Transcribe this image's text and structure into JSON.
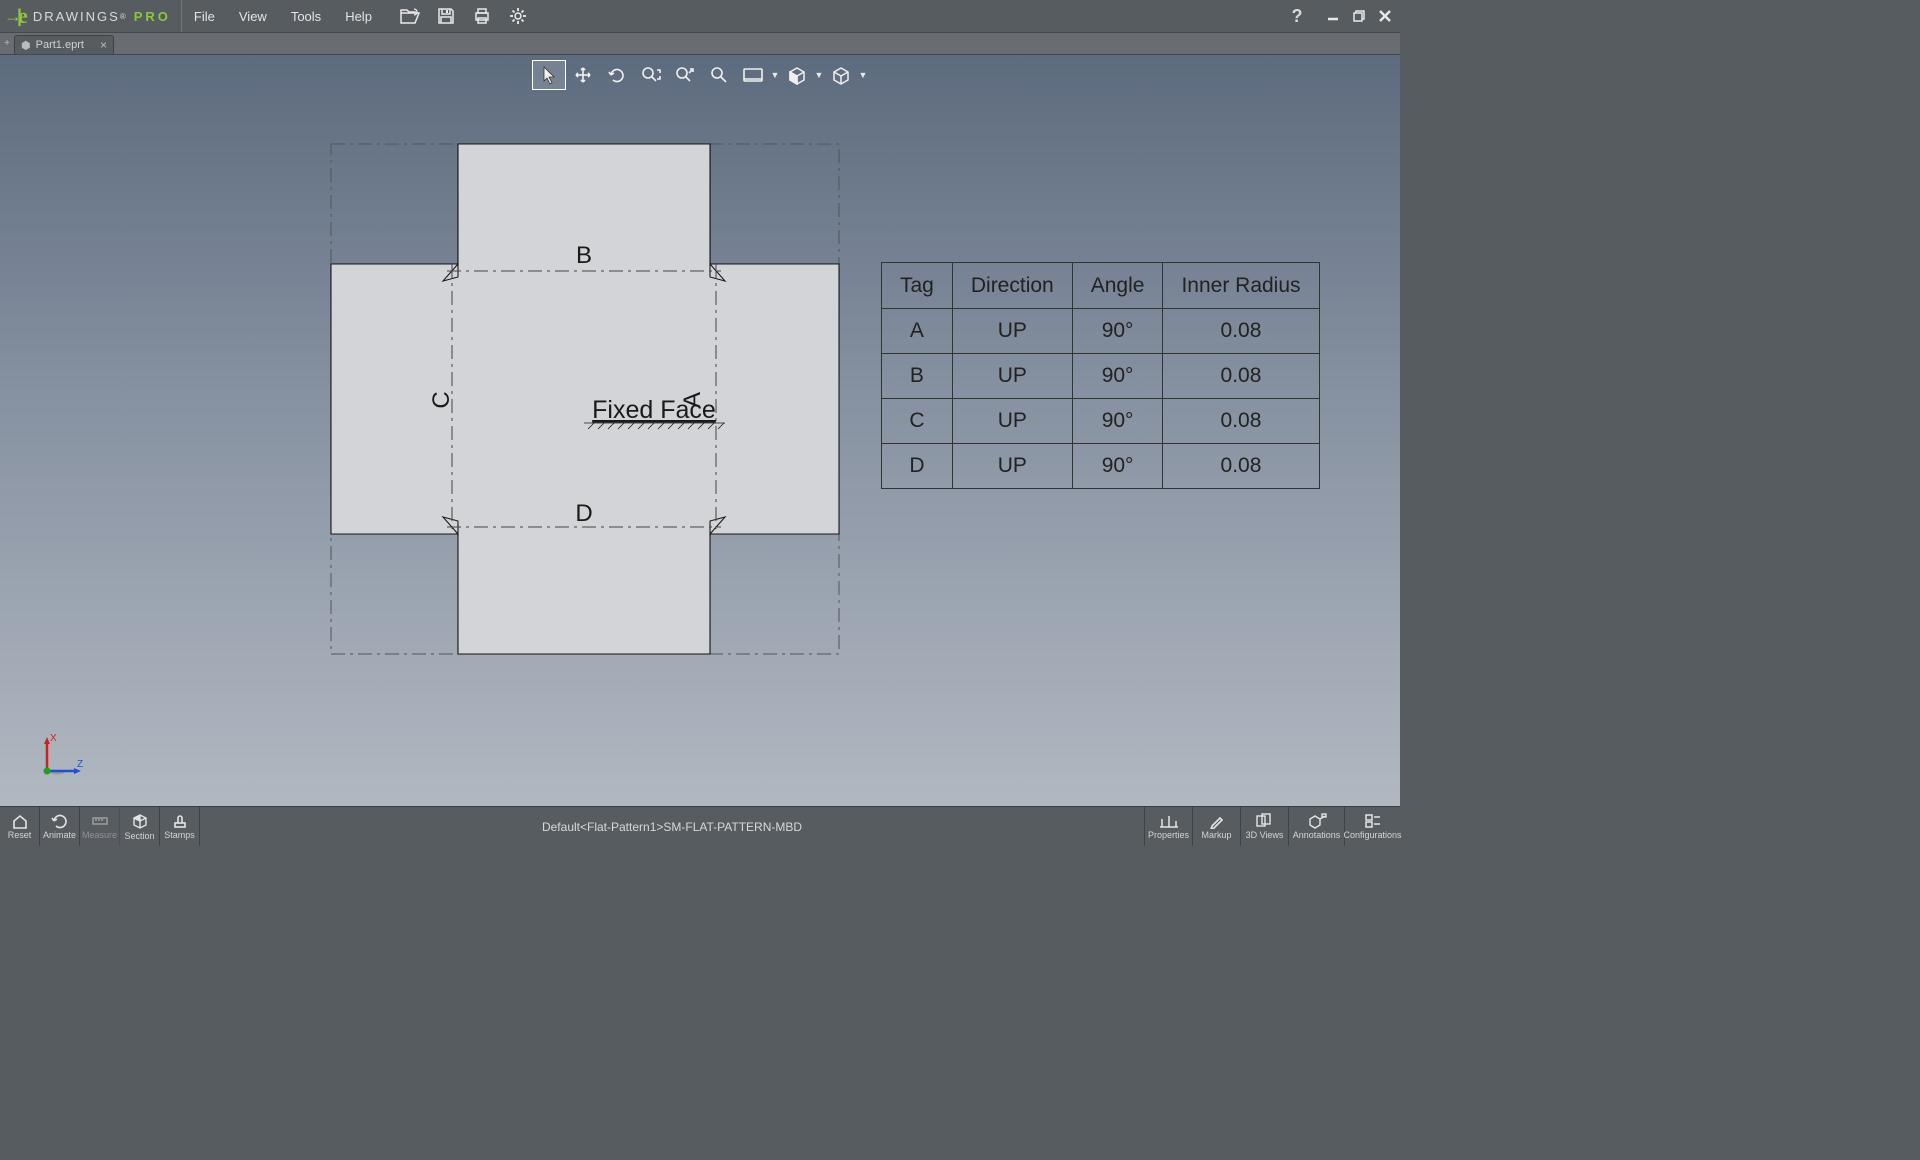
{
  "app": {
    "name1": "DRAWINGS",
    "name2": "PRO"
  },
  "menu": {
    "file": "File",
    "view": "View",
    "tools": "Tools",
    "help": "Help"
  },
  "tab": {
    "title": "Part1.eprt"
  },
  "drawing": {
    "fixed_face": "Fixed Face",
    "label_a": "A",
    "label_b": "B",
    "label_c": "C",
    "label_d": "D"
  },
  "bend_table": {
    "headers": {
      "tag": "Tag",
      "direction": "Direction",
      "angle": "Angle",
      "radius": "Inner Radius"
    },
    "rows": [
      {
        "tag": "A",
        "direction": "UP",
        "angle": "90°",
        "radius": "0.08"
      },
      {
        "tag": "B",
        "direction": "UP",
        "angle": "90°",
        "radius": "0.08"
      },
      {
        "tag": "C",
        "direction": "UP",
        "angle": "90°",
        "radius": "0.08"
      },
      {
        "tag": "D",
        "direction": "UP",
        "angle": "90°",
        "radius": "0.08"
      }
    ]
  },
  "triad": {
    "x": "X",
    "z": "Z"
  },
  "status": "Default<Flat-Pattern1>SM-FLAT-PATTERN-MBD",
  "bottom": {
    "reset": "Reset",
    "animate": "Animate",
    "measure": "Measure",
    "section": "Section",
    "stamps": "Stamps",
    "properties": "Properties",
    "markup": "Markup",
    "views3d": "3D Views",
    "annotations": "Annotations",
    "config": "Configurations"
  }
}
